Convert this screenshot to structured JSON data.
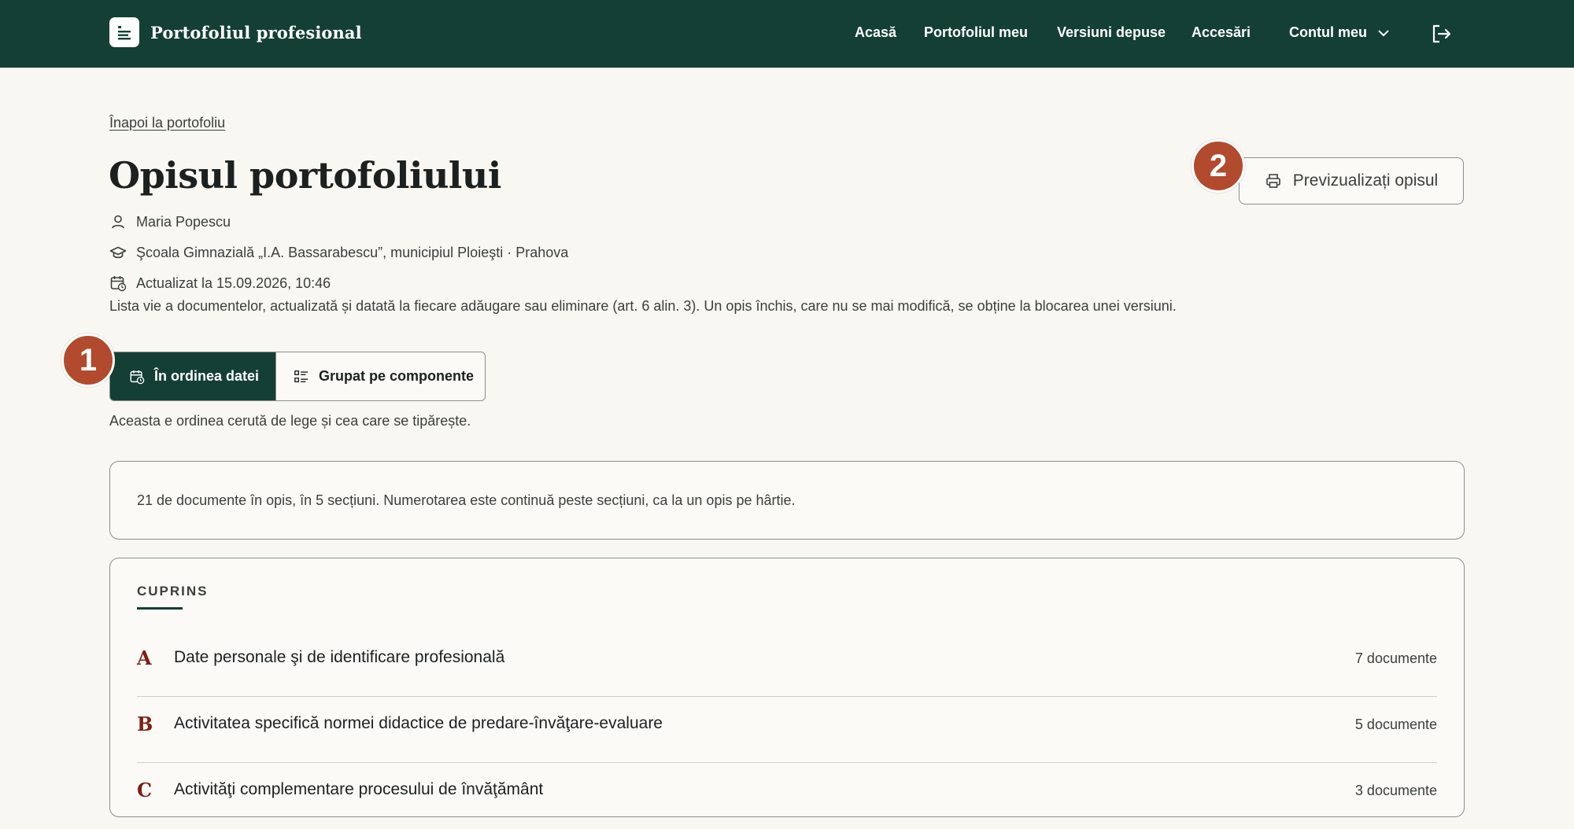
{
  "header": {
    "brand_title": "Portofoliul profesional",
    "nav": [
      "Acasă",
      "Portofoliul meu",
      "Versiuni depuse",
      "Accesări"
    ],
    "account_label": "Contul meu"
  },
  "page": {
    "back_link": "Înapoi la portofoliu",
    "title": "Opisul portofoliului",
    "person": "Maria Popescu",
    "school": "Şcoala Gimnazială „I.A. Bassarabescu”, municipiul Ploieşti · Prahova",
    "updated": "Actualizat la 15.09.2026, 10:46",
    "description": "Lista vie a documentelor, actualizată și datată la fiecare adăugare sau eliminare (art. 6 alin. 3). Un opis închis, care nu se mai modifică, se obține la blocarea unei versiuni.",
    "preview_button": "Previzualizați opisul"
  },
  "badges": [
    "1",
    "2"
  ],
  "view_toggle": {
    "options": [
      "În ordinea datei",
      "Grupat pe componente"
    ],
    "selected": "În ordinea datei",
    "hint": "Aceasta e ordinea cerută de lege și cea care se tipărește."
  },
  "summary": "21 de documente în opis, în 5 secțiuni. Numerotarea este continuă peste secțiuni, ca la un opis pe hârtie.",
  "toc": {
    "heading": "CUPRINS",
    "sections": [
      {
        "letter": "A",
        "title": "Date personale şi de identificare profesională",
        "count": "7 documente"
      },
      {
        "letter": "B",
        "title": "Activitatea specifică normei didactice de predare-învăţare-evaluare",
        "count": "5 documente"
      },
      {
        "letter": "C",
        "title": "Activităţi complementare procesului de învăţământ",
        "count": "3 documente"
      }
    ]
  },
  "colors": {
    "header_bg": "#143f34",
    "page_bg": "#f8f7f2",
    "badge": "#b24a2e",
    "section_letter": "#7d1f14"
  }
}
